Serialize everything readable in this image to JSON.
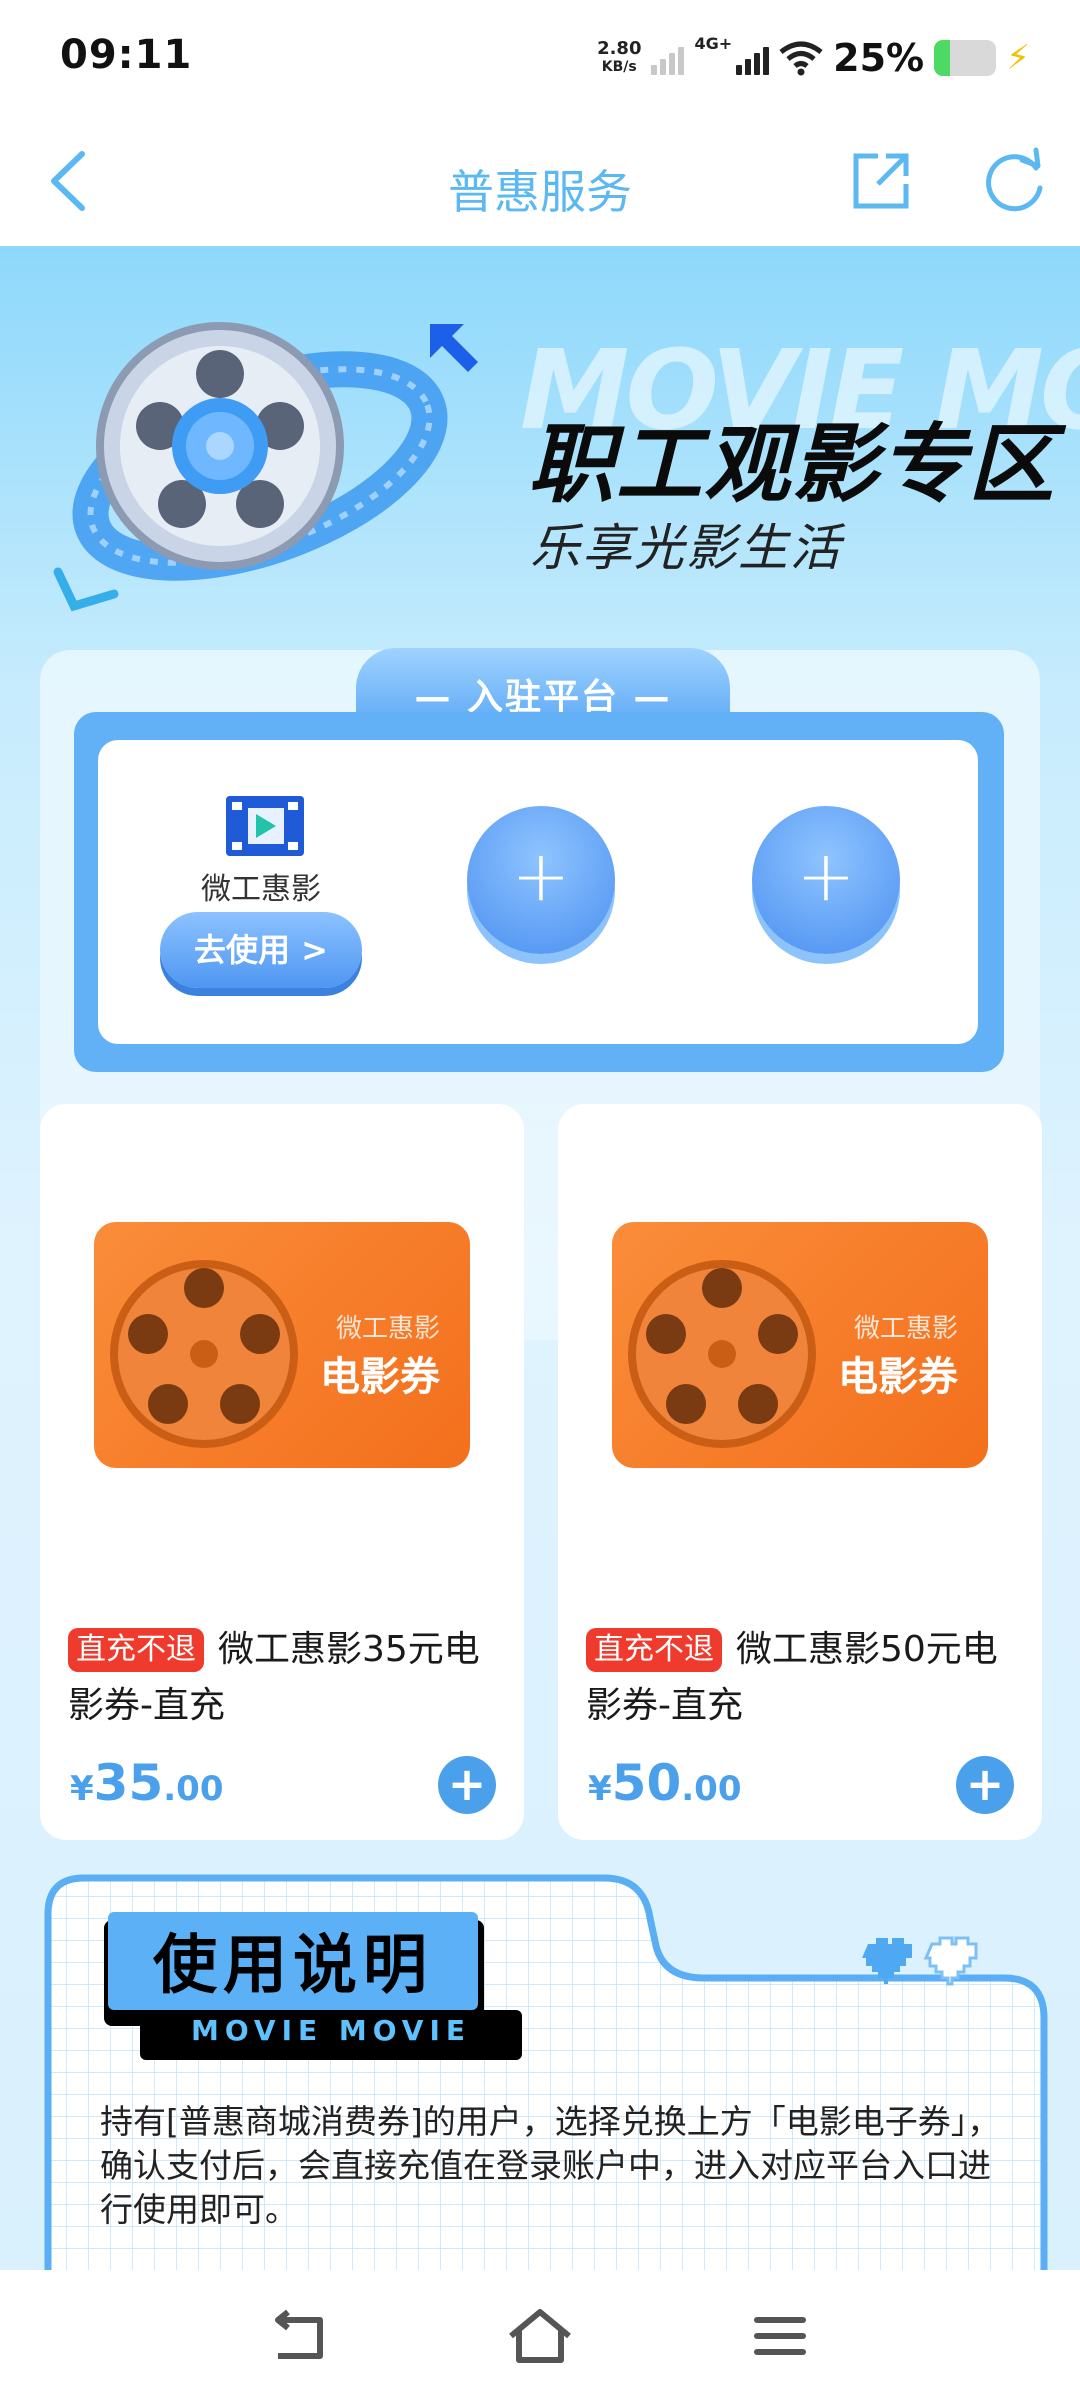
{
  "status_bar": {
    "time": "09:11",
    "speed_value": "2.80",
    "speed_unit": "KB/s",
    "network": "4G+",
    "battery": "25%",
    "battery_level": 0.25
  },
  "header": {
    "title": "普惠服务"
  },
  "hero": {
    "bg_text": "MOVIE MOVIE",
    "title": "职工观影专区",
    "subtitle": "乐享光影生活"
  },
  "platforms": {
    "section_label": "— 入驻平台 —",
    "items": [
      {
        "name": "微工惠影",
        "action_label": "去使用 >"
      }
    ],
    "add_symbol": "+"
  },
  "products": [
    {
      "image_brand": "微工惠影",
      "image_label": "电影券",
      "badge": "直充不退",
      "name": "微工惠影35元电影券-直充",
      "currency": "¥",
      "price_int": "35",
      "price_dec": ".00",
      "add_symbol": "+"
    },
    {
      "image_brand": "微工惠影",
      "image_label": "电影券",
      "badge": "直充不退",
      "name": "微工惠影50元电影券-直充",
      "currency": "¥",
      "price_int": "50",
      "price_dec": ".00",
      "add_symbol": "+"
    }
  ],
  "usage": {
    "title": "使用说明",
    "subtitle": "MOVIE MOVIE",
    "text": "持有[普惠商城消费券]的用户，选择兑换上方「电影电子券」，确认支付后，会直接充值在登录账户中，进入对应平台入口进行使用即可。"
  },
  "icons": {
    "back": "chevron-left-icon",
    "share": "share-external-icon",
    "refresh": "refresh-icon",
    "nav_back": "nav-back-icon",
    "nav_home": "home-icon",
    "nav_menu": "menu-icon"
  },
  "colors": {
    "accent": "#5bb8f0",
    "price": "#4aa0ea",
    "badge": "#ef3b2d",
    "card_image": "#f47a28"
  }
}
